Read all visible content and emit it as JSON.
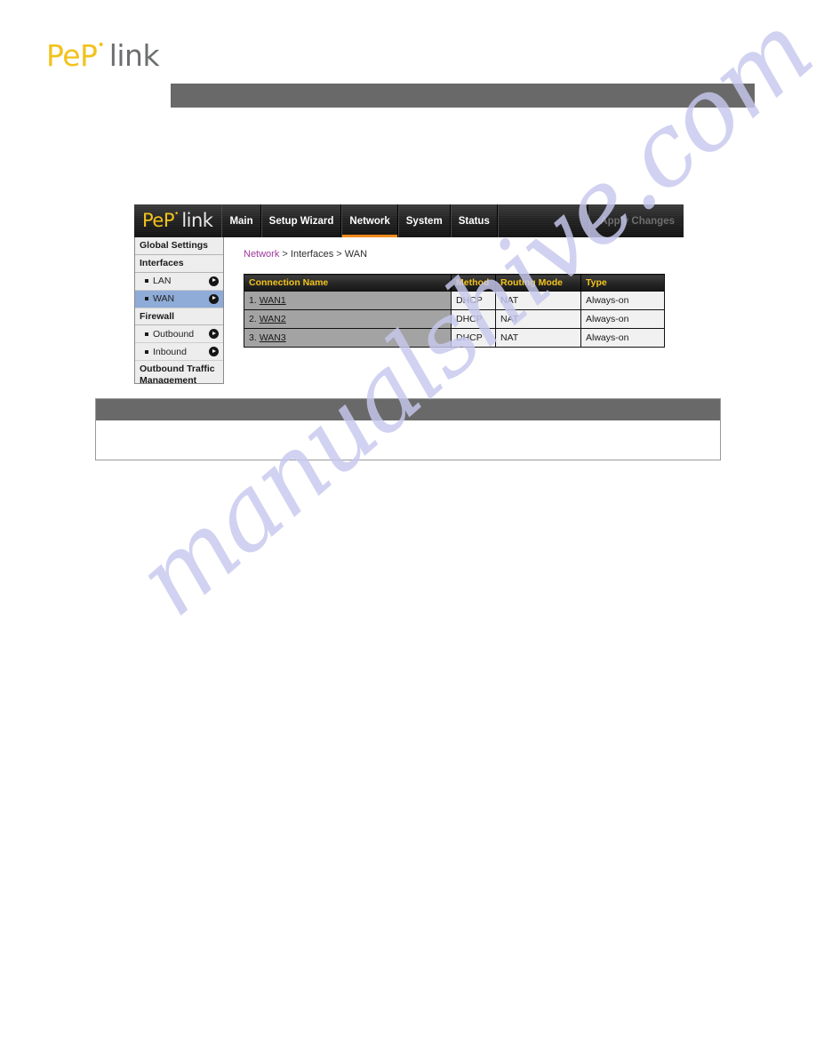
{
  "document": {
    "logo": {
      "brand_first": "PeP",
      "brand_mark": "•",
      "brand_second": "link"
    }
  },
  "watermark": {
    "text": "manualshive.com",
    "color": "#c8c9ee"
  },
  "router_ui": {
    "logo": {
      "brand_first": "PeP",
      "brand_mark": "•",
      "brand_second": "link"
    },
    "nav_tabs": [
      {
        "label": "Main",
        "active": false
      },
      {
        "label": "Setup Wizard",
        "active": false
      },
      {
        "label": "Network",
        "active": true
      },
      {
        "label": "System",
        "active": false
      },
      {
        "label": "Status",
        "active": false
      }
    ],
    "apply_button": {
      "label": "Apply Changes",
      "state": "disabled"
    },
    "sidebar": {
      "groups": [
        {
          "label": "Global Settings"
        },
        {
          "label": "Interfaces"
        },
        {
          "label": "Firewall"
        },
        {
          "label": "Outbound Traffic Management"
        }
      ],
      "items": [
        {
          "label": "LAN",
          "selected": false
        },
        {
          "label": "WAN",
          "selected": true
        },
        {
          "label": "Outbound",
          "selected": false
        },
        {
          "label": "Inbound",
          "selected": false
        }
      ]
    },
    "breadcrumb": {
      "link": "Network",
      "sep1": ">",
      "mid": "Interfaces",
      "sep2": ">",
      "current": "WAN"
    },
    "table": {
      "columns": [
        "Connection Name",
        "Method",
        "Routing Mode",
        "Type"
      ],
      "rows": [
        {
          "index": "1.",
          "name": "WAN1",
          "method": "DHCP",
          "routing_mode": "NAT",
          "type": "Always-on"
        },
        {
          "index": "2.",
          "name": "WAN2",
          "method": "DHCP",
          "routing_mode": "NAT",
          "type": "Always-on"
        },
        {
          "index": "3.",
          "name": "WAN3",
          "method": "DHCP",
          "routing_mode": "NAT",
          "type": "Always-on"
        }
      ]
    }
  },
  "colors": {
    "brand_gold": "#f2c21c",
    "accent_orange": "#f08a1e",
    "selected_blue": "#8fabd7",
    "breadcrumb_link": "#a0389b",
    "header_gray": "#696969"
  }
}
